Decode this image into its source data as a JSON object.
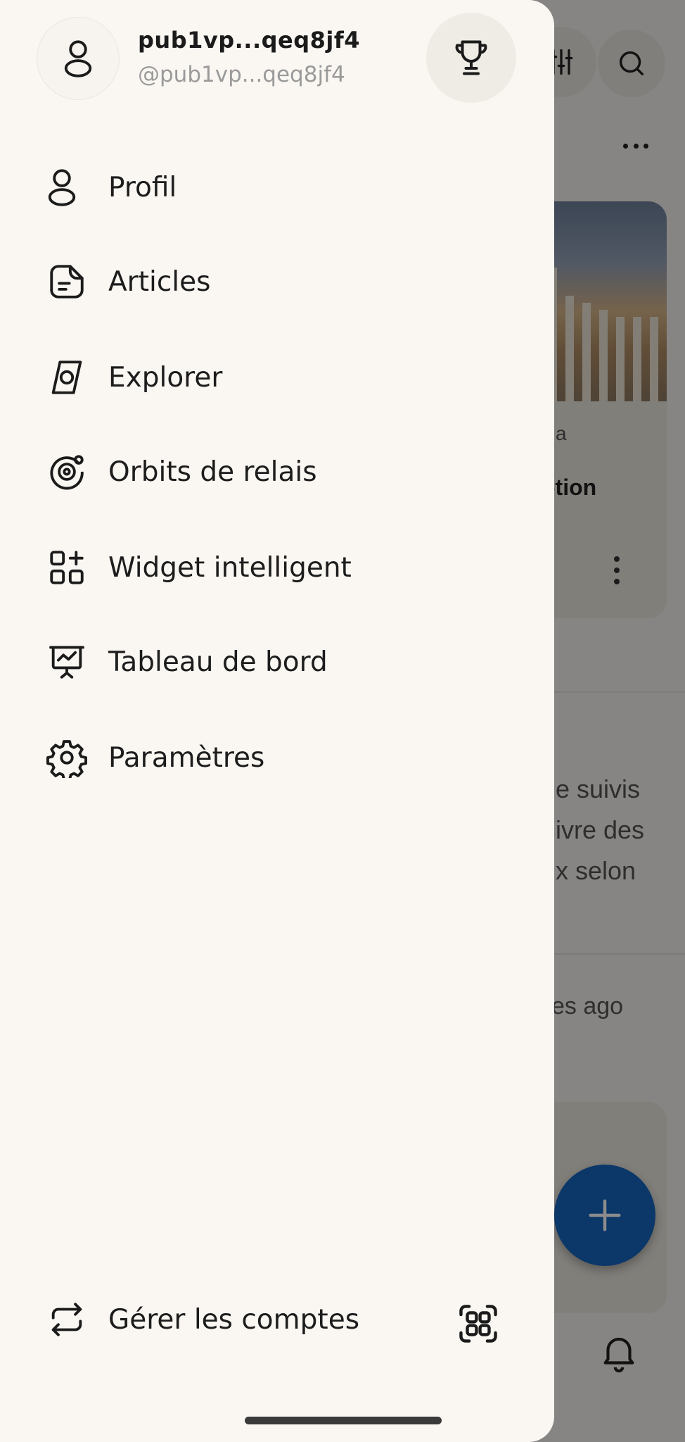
{
  "drawer": {
    "display_name": "pub1vp...qeq8jf4",
    "handle": "@pub1vp...qeq8jf4",
    "menu": [
      {
        "label": "Profil",
        "icon": "user-icon"
      },
      {
        "label": "Articles",
        "icon": "article-icon"
      },
      {
        "label": "Explorer",
        "icon": "compass-icon"
      },
      {
        "label": "Orbits de relais",
        "icon": "orbit-icon"
      },
      {
        "label": "Widget intelligent",
        "icon": "widget-grid-icon"
      },
      {
        "label": "Tableau de bord",
        "icon": "dashboard-icon"
      },
      {
        "label": "Paramètres",
        "icon": "gear-icon"
      }
    ],
    "manage_accounts": "Gérer les comptes"
  },
  "background": {
    "card_author_fragment": "a",
    "card_title_fragment": "ption",
    "text_line_1": "e suivis",
    "text_line_2": "ivre des",
    "text_line_3": "x selon",
    "timestamp_fragment": "es ago"
  },
  "colors": {
    "drawer_bg": "#faf7f2",
    "fab": "#1565c0",
    "text": "#1d1d1d",
    "muted": "#9a9a9a"
  }
}
